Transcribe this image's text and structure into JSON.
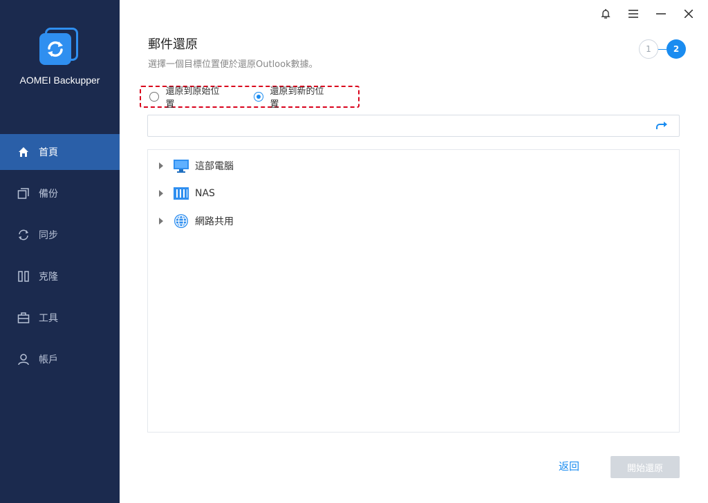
{
  "app": {
    "name": "AOMEI Backupper"
  },
  "sidebar": {
    "items": [
      {
        "label": "首頁",
        "icon": "home-icon",
        "active": true
      },
      {
        "label": "備份",
        "icon": "backup-icon",
        "active": false
      },
      {
        "label": "同步",
        "icon": "sync-icon",
        "active": false
      },
      {
        "label": "克隆",
        "icon": "clone-icon",
        "active": false
      },
      {
        "label": "工具",
        "icon": "tools-icon",
        "active": false
      },
      {
        "label": "帳戶",
        "icon": "account-icon",
        "active": false
      }
    ]
  },
  "titlebar": {
    "icons": [
      "bell-icon",
      "menu-icon",
      "minimize-icon",
      "close-icon"
    ]
  },
  "main": {
    "title": "郵件還原",
    "subtitle": "選擇一個目標位置便於還原Outlook數據。",
    "steps": [
      "1",
      "2"
    ],
    "current_step": 2,
    "radio_options": [
      {
        "label": "還原到原始位置",
        "checked": false
      },
      {
        "label": "還原到新的位置",
        "checked": true
      }
    ],
    "path_input": {
      "value": "",
      "placeholder": ""
    },
    "tree": [
      {
        "label": "這部電腦",
        "icon": "computer-icon"
      },
      {
        "label": "NAS",
        "icon": "nas-icon"
      },
      {
        "label": "網路共用",
        "icon": "network-share-icon"
      }
    ],
    "back_label": "返回",
    "start_label": "開始還原"
  },
  "colors": {
    "sidebar_bg": "#1b2a4e",
    "active_nav": "#2a5fa8",
    "accent": "#1a8cf0",
    "highlight_border": "#d9001b",
    "disabled_button": "#d3d8de"
  }
}
